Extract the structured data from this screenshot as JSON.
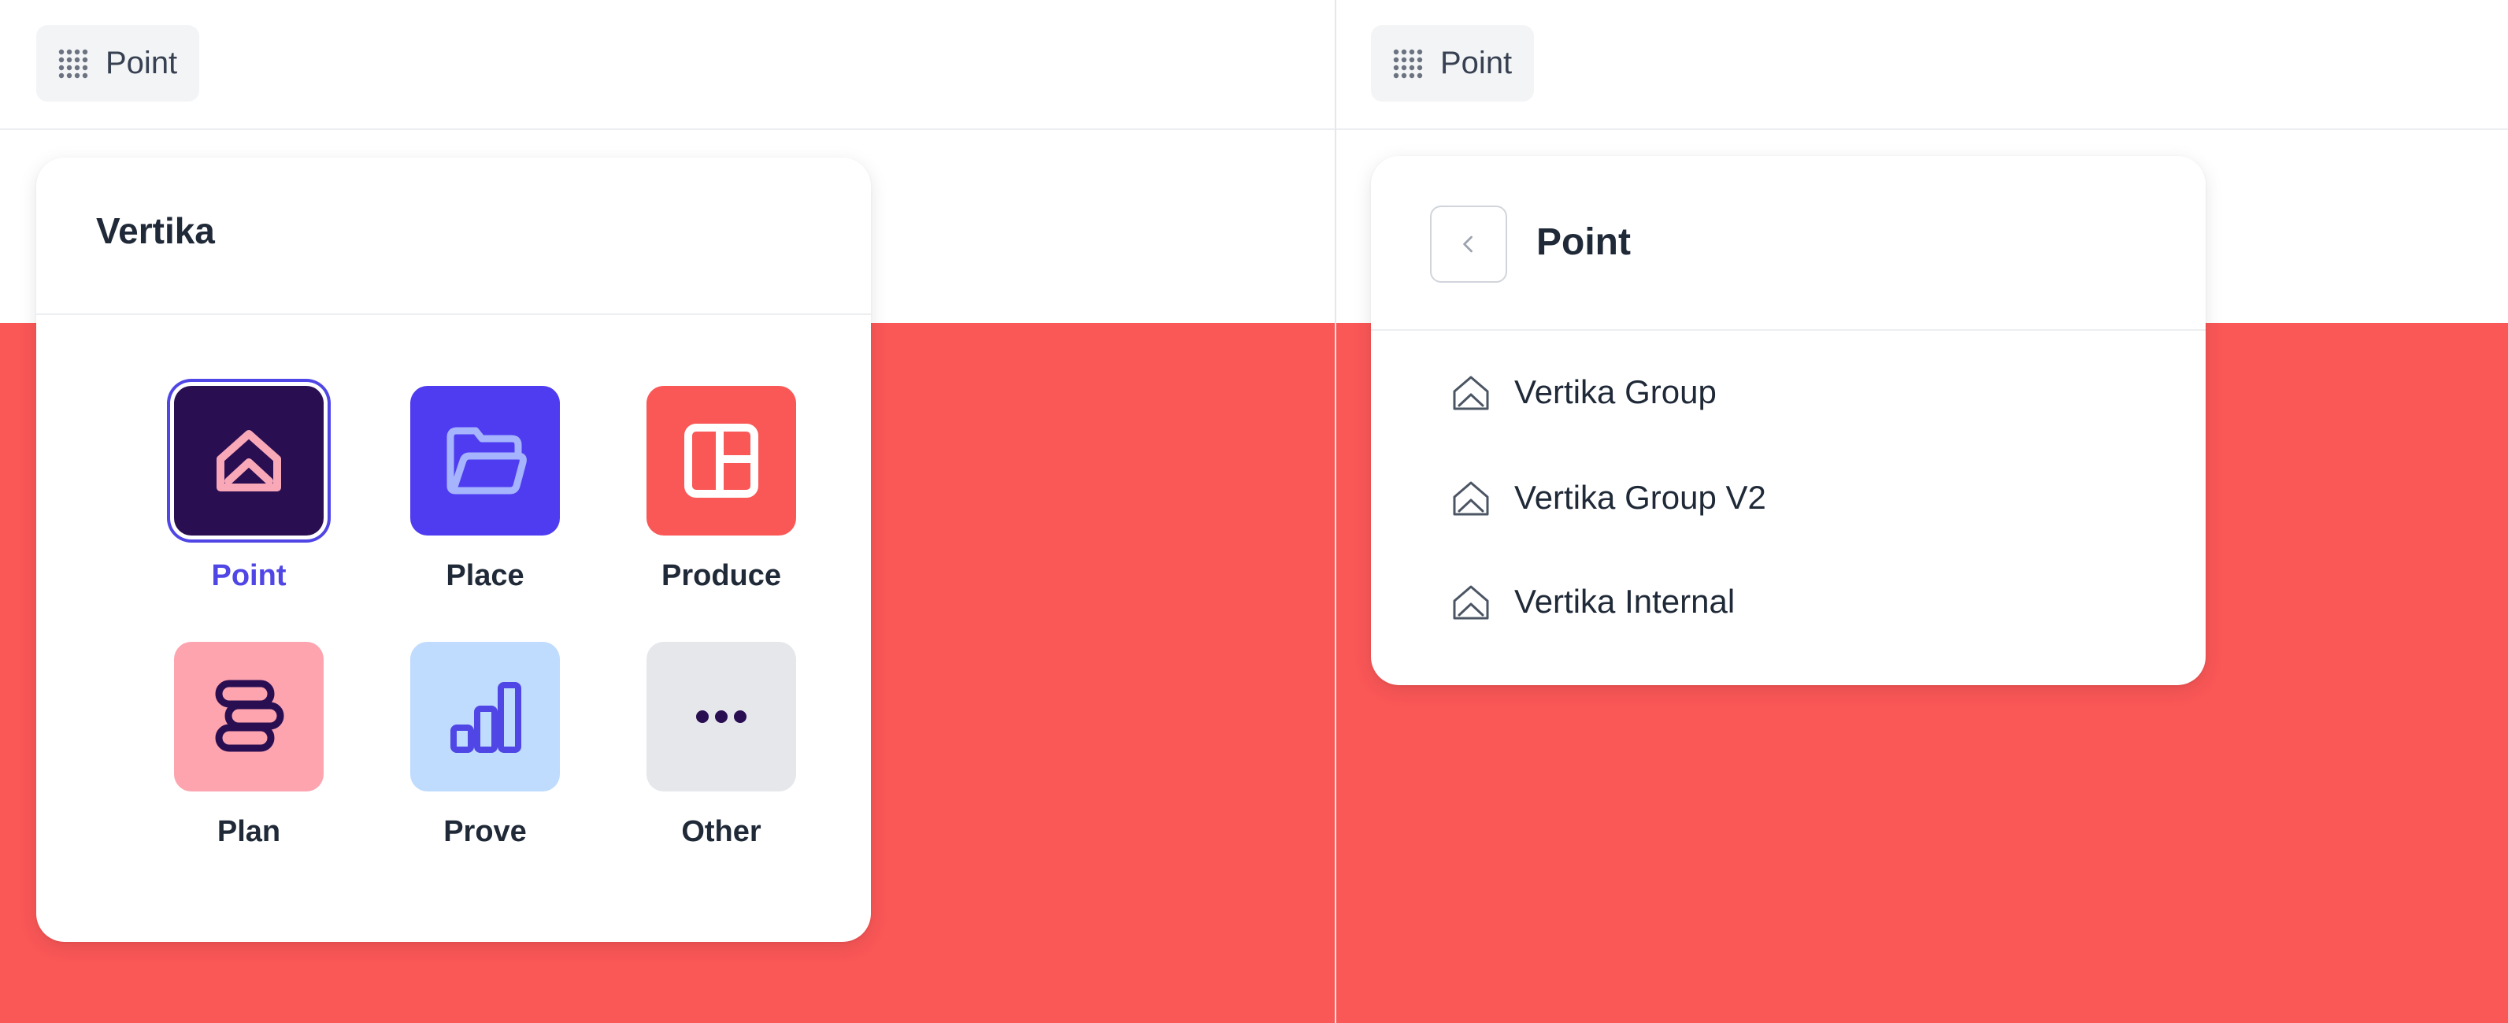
{
  "left_panel": {
    "switcher_label": "Point",
    "card_title": "Vertika",
    "apps": [
      {
        "label": "Point",
        "icon": "point-icon",
        "bg": "#2a0e52",
        "fg": "#f9a8b8",
        "active": true
      },
      {
        "label": "Place",
        "icon": "folder-icon",
        "bg": "#4f3cf0",
        "fg": "#a5b4fc",
        "active": false
      },
      {
        "label": "Produce",
        "icon": "layout-icon",
        "bg": "#fa5757",
        "fg": "#ffffff",
        "active": false
      },
      {
        "label": "Plan",
        "icon": "stack-icon",
        "bg": "#fda4af",
        "fg": "#2a0e52",
        "active": false
      },
      {
        "label": "Prove",
        "icon": "bar-chart-icon",
        "bg": "#bfdbfe",
        "fg": "#4f46e5",
        "active": false
      },
      {
        "label": "Other",
        "icon": "more-icon",
        "bg": "#e5e7eb",
        "fg": "#2a0e52",
        "active": false
      }
    ]
  },
  "right_panel": {
    "switcher_label": "Point",
    "card_title": "Point",
    "orgs": [
      {
        "label": "Vertika Group",
        "icon": "point-outline-icon"
      },
      {
        "label": "Vertika Group V2",
        "icon": "point-outline-icon"
      },
      {
        "label": "Vertika Internal",
        "icon": "point-outline-icon"
      }
    ]
  },
  "colors": {
    "accent": "#4f46e5",
    "brand_red": "#fa5757"
  }
}
